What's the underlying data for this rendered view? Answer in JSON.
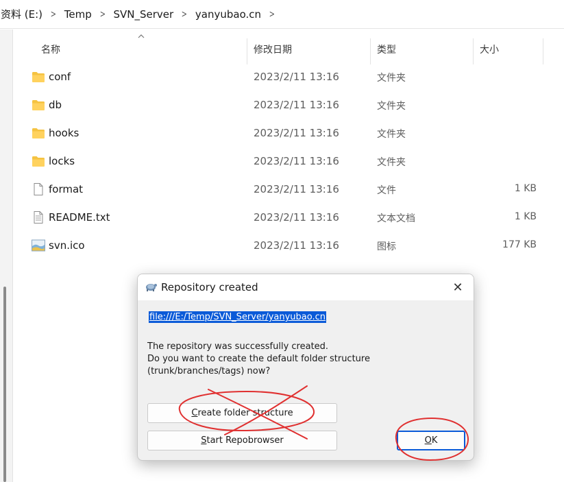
{
  "breadcrumb": {
    "items": [
      "资料 (E:)",
      "Temp",
      "SVN_Server",
      "yanyubao.cn"
    ],
    "separator": ">"
  },
  "columns": {
    "name": "名称",
    "modified": "修改日期",
    "type": "类型",
    "size": "大小"
  },
  "files": [
    {
      "name": "conf",
      "modified": "2023/2/11 13:16",
      "type": "文件夹",
      "size": "",
      "icon": "folder-icon"
    },
    {
      "name": "db",
      "modified": "2023/2/11 13:16",
      "type": "文件夹",
      "size": "",
      "icon": "folder-icon"
    },
    {
      "name": "hooks",
      "modified": "2023/2/11 13:16",
      "type": "文件夹",
      "size": "",
      "icon": "folder-icon"
    },
    {
      "name": "locks",
      "modified": "2023/2/11 13:16",
      "type": "文件夹",
      "size": "",
      "icon": "folder-icon"
    },
    {
      "name": "format",
      "modified": "2023/2/11 13:16",
      "type": "文件",
      "size": "1 KB",
      "icon": "file-icon"
    },
    {
      "name": "README.txt",
      "modified": "2023/2/11 13:16",
      "type": "文本文档",
      "size": "1 KB",
      "icon": "text-file-icon"
    },
    {
      "name": "svn.ico",
      "modified": "2023/2/11 13:16",
      "type": "图标",
      "size": "177 KB",
      "icon": "image-file-icon"
    }
  ],
  "dialog": {
    "title": "Repository created",
    "url": "file:///E:/Temp/SVN_Server/yanyubao.cn",
    "message_lines": [
      "The repository was successfully created.",
      "Do you want to create the default folder structure",
      "(trunk/branches/tags) now?"
    ],
    "create_button": {
      "mnemonic": "C",
      "rest": "reate folder structure"
    },
    "repo_button": {
      "mnemonic": "S",
      "rest": "tart Repobrowser"
    },
    "ok_button": {
      "mnemonic": "O",
      "rest": "K"
    },
    "close_glyph": "✕"
  },
  "colors": {
    "folder": "#f5c342",
    "selection": "#0a5ad8",
    "annotation_red": "#e03030"
  }
}
